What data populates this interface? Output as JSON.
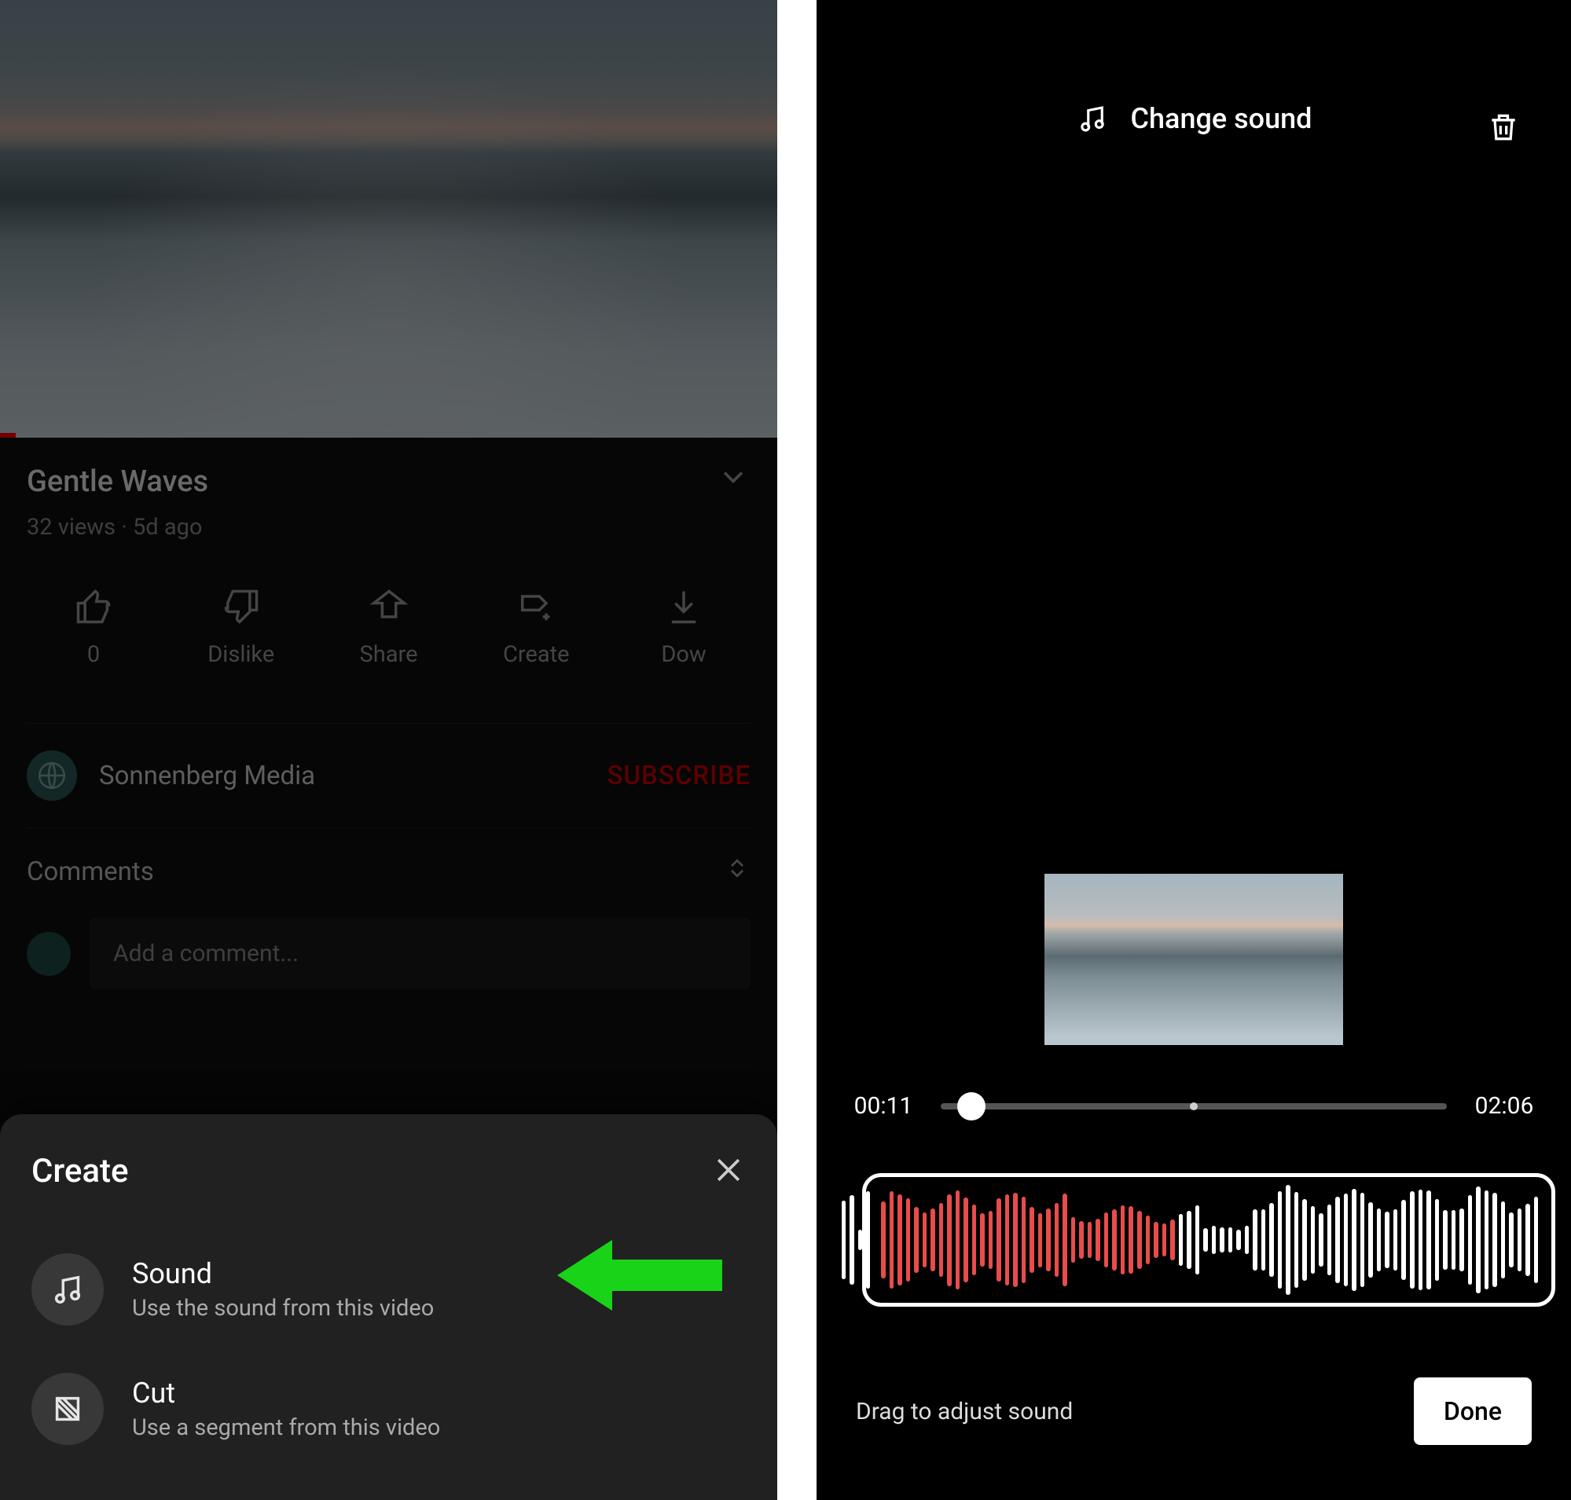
{
  "left": {
    "video_title": "Gentle Waves",
    "meta": "32 views · 5d ago",
    "actions": {
      "like_count": "0",
      "dislike": "Dislike",
      "share": "Share",
      "create": "Create",
      "download": "Dow"
    },
    "channel_name": "Sonnenberg Media",
    "subscribe": "SUBSCRIBE",
    "comments_header": "Comments",
    "comment_placeholder": "Add a comment...",
    "sheet": {
      "title": "Create",
      "sound": {
        "title": "Sound",
        "sub": "Use the sound from this video"
      },
      "cut": {
        "title": "Cut",
        "sub": "Use a segment from this video"
      }
    }
  },
  "right": {
    "change_sound": "Change sound",
    "time_current": "00:11",
    "time_total": "02:06",
    "drag_hint": "Drag to adjust sound",
    "done": "Done"
  }
}
